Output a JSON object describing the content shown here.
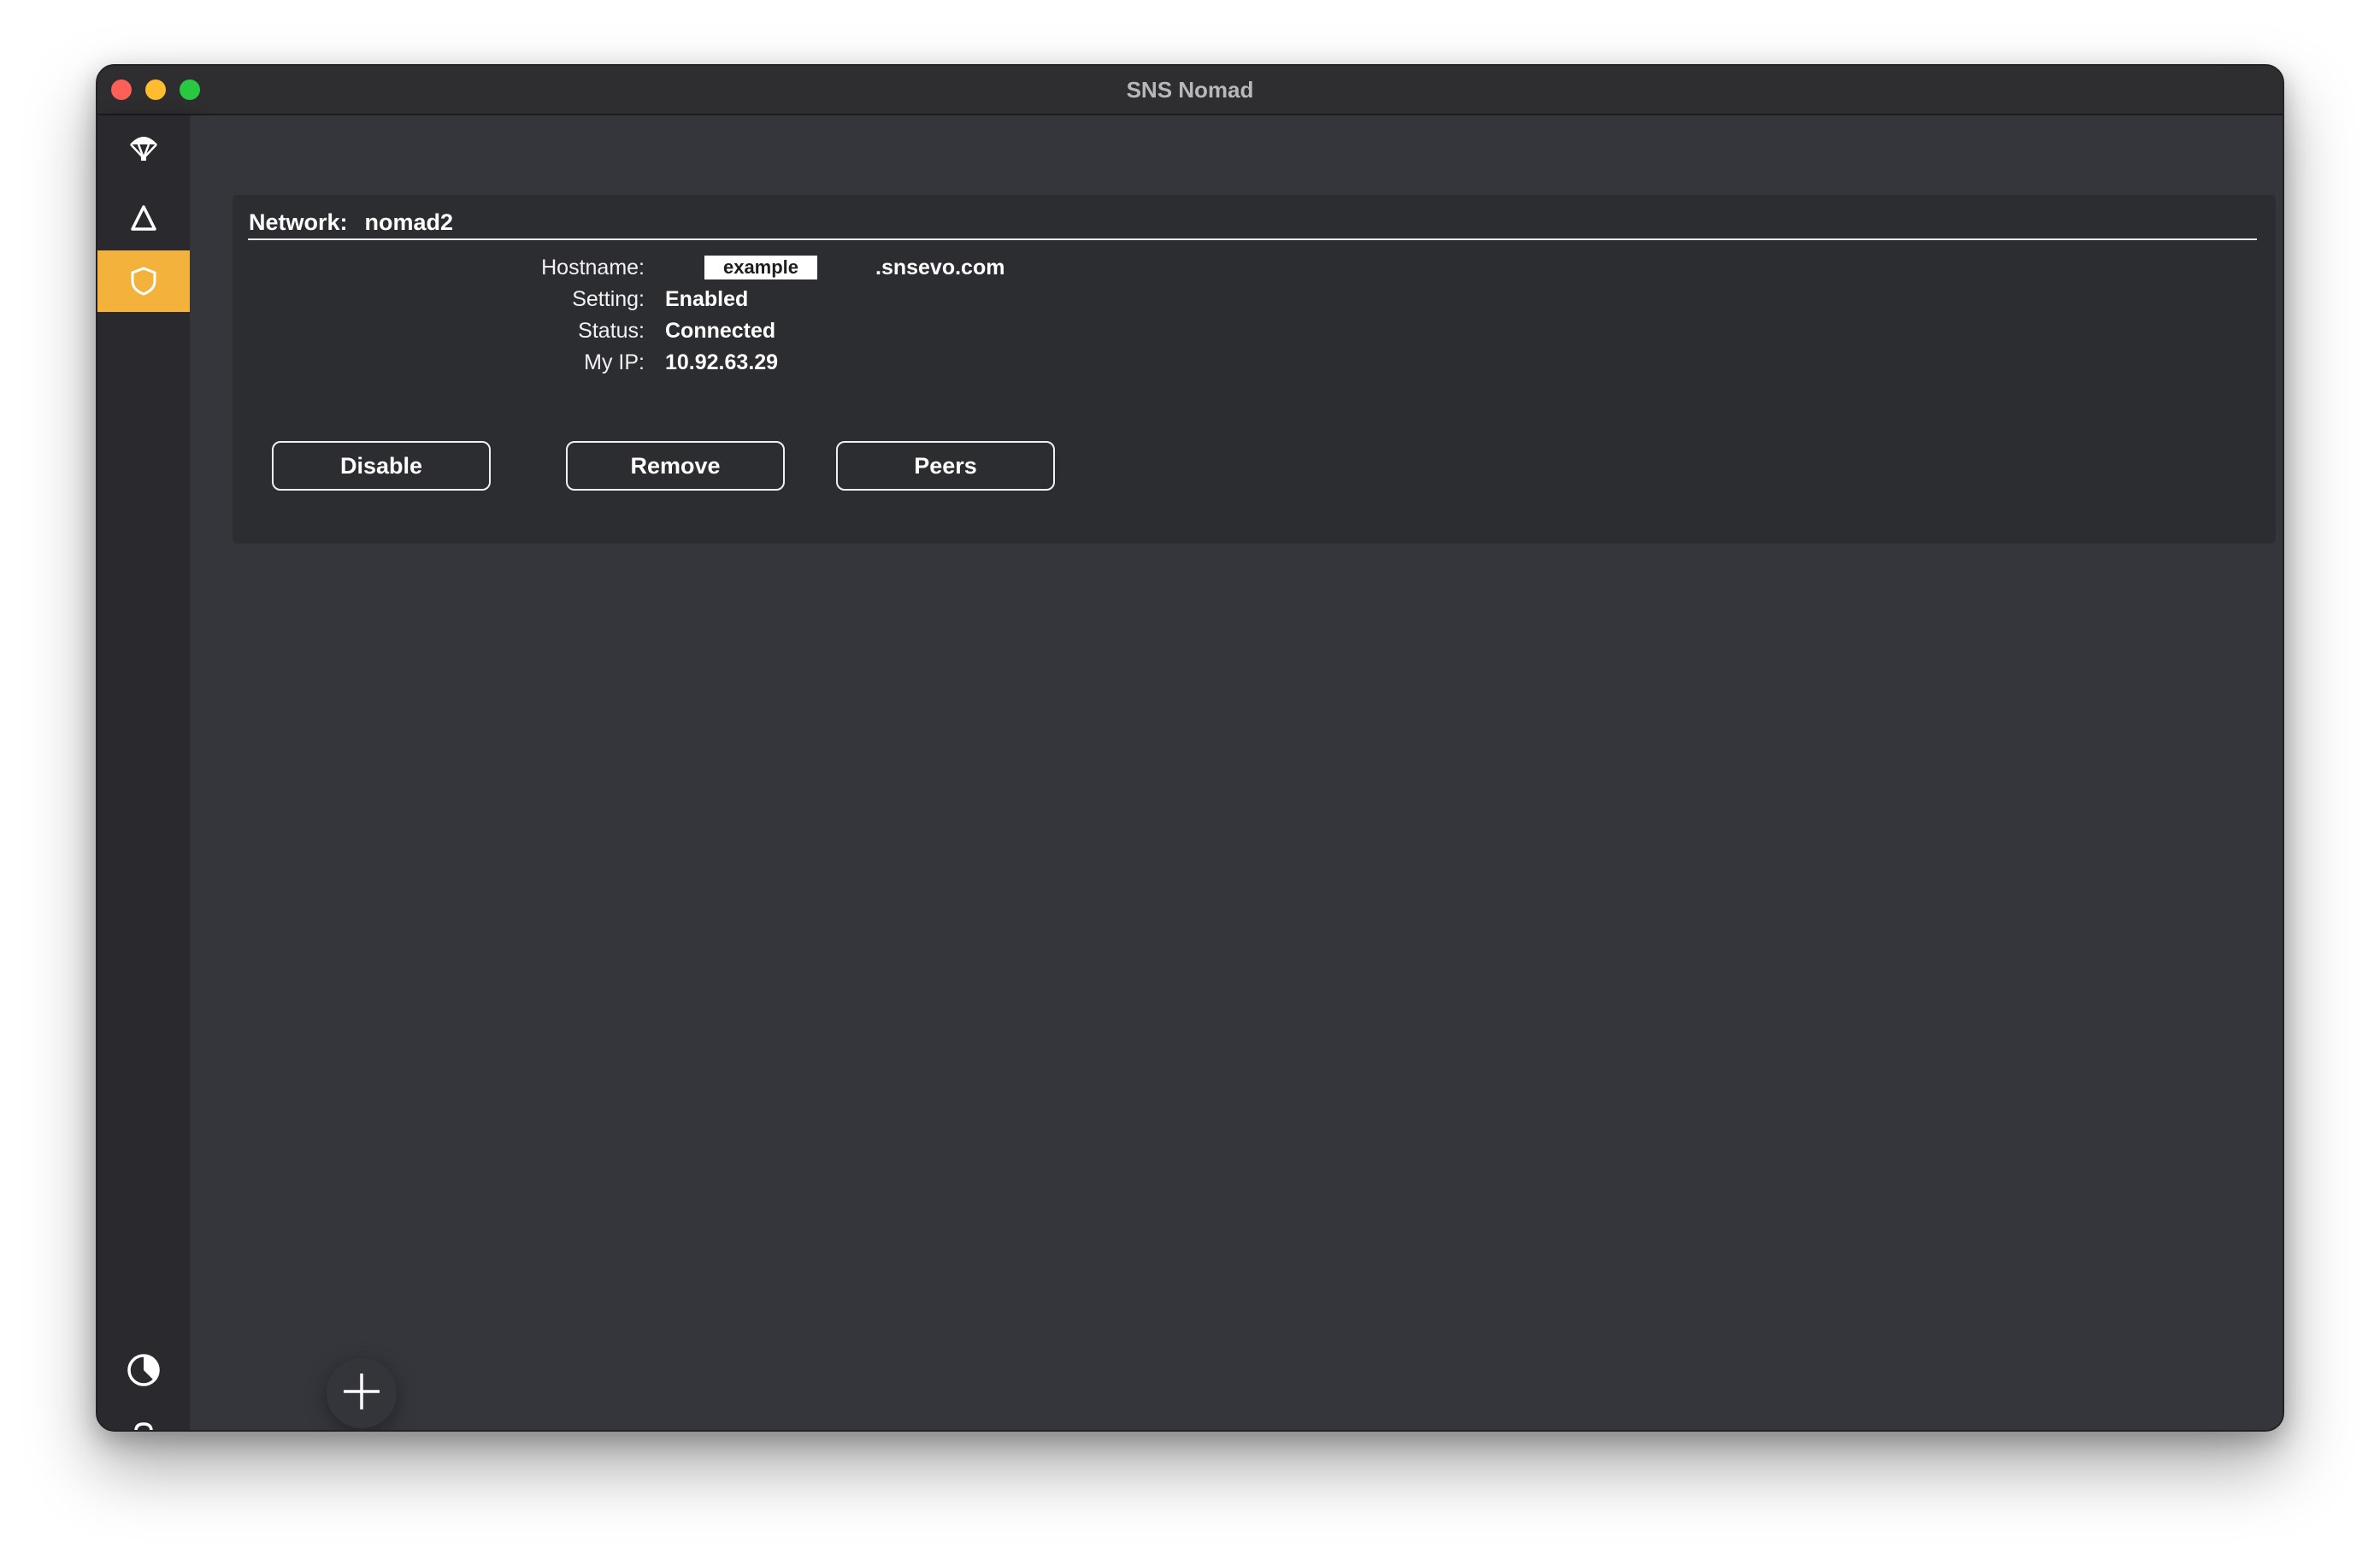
{
  "window": {
    "title": "SNS Nomad"
  },
  "sidebar": {
    "items": [
      {
        "icon": "parachute-icon",
        "active": false
      },
      {
        "icon": "delta-icon",
        "active": false
      },
      {
        "icon": "shield-icon",
        "active": true
      }
    ],
    "bottom_items": [
      {
        "icon": "contrast-icon"
      },
      {
        "icon": "help-icon"
      }
    ],
    "accent_color": "#f3b23c"
  },
  "network": {
    "label": "Network:",
    "name": "nomad2",
    "fields": {
      "hostname_label": "Hostname:",
      "hostname_value": "example",
      "hostname_domain": ".snsevo.com",
      "setting_label": "Setting:",
      "setting_value": "Enabled",
      "status_label": "Status:",
      "status_value": "Connected",
      "myip_label": "My IP:",
      "myip_value": "10.92.63.29"
    },
    "buttons": {
      "disable": "Disable",
      "remove": "Remove",
      "peers": "Peers"
    }
  },
  "fab": {
    "icon": "plus-icon"
  }
}
